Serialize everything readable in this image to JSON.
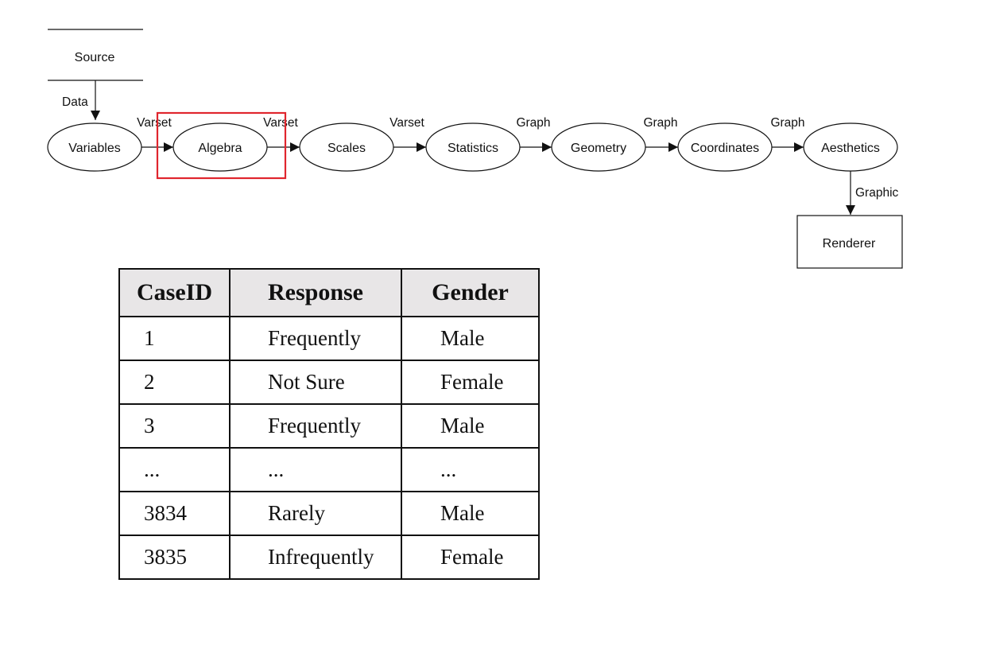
{
  "diagram": {
    "source": "Source",
    "renderer": "Renderer",
    "edges": {
      "data": "Data",
      "graphic": "Graphic"
    },
    "nodes": [
      {
        "id": "variables",
        "label": "Variables"
      },
      {
        "id": "algebra",
        "label": "Algebra"
      },
      {
        "id": "scales",
        "label": "Scales"
      },
      {
        "id": "statistics",
        "label": "Statistics"
      },
      {
        "id": "geometry",
        "label": "Geometry"
      },
      {
        "id": "coordinates",
        "label": "Coordinates"
      },
      {
        "id": "aesthetics",
        "label": "Aesthetics"
      }
    ],
    "links": [
      "Varset",
      "Varset",
      "Varset",
      "Graph",
      "Graph",
      "Graph"
    ],
    "highlight_color": "#e0262e"
  },
  "table": {
    "headers": [
      "CaseID",
      "Response",
      "Gender"
    ],
    "rows": [
      [
        "1",
        "Frequently",
        "Male"
      ],
      [
        "2",
        "Not Sure",
        "Female"
      ],
      [
        "3",
        "Frequently",
        "Male"
      ],
      [
        "...",
        "...",
        "..."
      ],
      [
        "3834",
        "Rarely",
        "Male"
      ],
      [
        "3835",
        "Infrequently",
        "Female"
      ]
    ]
  }
}
